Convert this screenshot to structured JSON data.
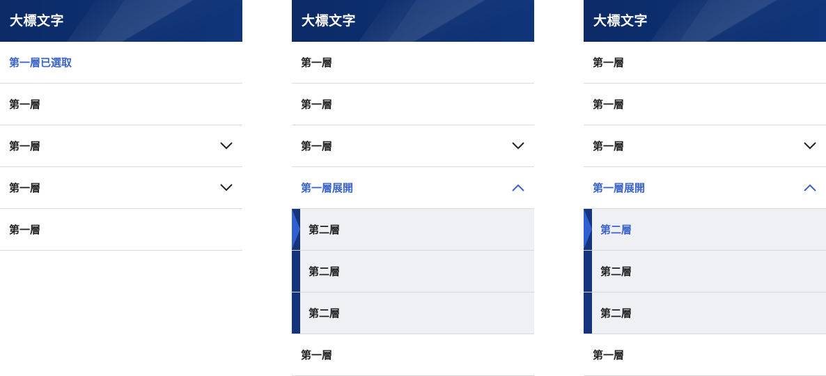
{
  "panels": [
    {
      "title": "大標文字",
      "items": [
        {
          "label": "第一層已選取",
          "active": true,
          "chevron": ""
        },
        {
          "label": "第一層",
          "active": false,
          "chevron": ""
        },
        {
          "label": "第一層",
          "active": false,
          "chevron": "down"
        },
        {
          "label": "第一層",
          "active": false,
          "chevron": "down"
        },
        {
          "label": "第一層",
          "active": false,
          "chevron": ""
        }
      ]
    },
    {
      "title": "大標文字",
      "items": [
        {
          "label": "第一層",
          "active": false,
          "chevron": ""
        },
        {
          "label": "第一層",
          "active": false,
          "chevron": ""
        },
        {
          "label": "第一層",
          "active": false,
          "chevron": "down"
        },
        {
          "label": "第一層展開",
          "active": true,
          "chevron": "up"
        }
      ],
      "sub_items": [
        {
          "label": "第二層",
          "active": false
        },
        {
          "label": "第二層",
          "active": false
        },
        {
          "label": "第二層",
          "active": false
        }
      ],
      "after_items": [
        {
          "label": "第一層",
          "active": false,
          "chevron": ""
        }
      ]
    },
    {
      "title": "大標文字",
      "items": [
        {
          "label": "第一層",
          "active": false,
          "chevron": ""
        },
        {
          "label": "第一層",
          "active": false,
          "chevron": ""
        },
        {
          "label": "第一層",
          "active": false,
          "chevron": "down"
        },
        {
          "label": "第一層展開",
          "active": true,
          "chevron": "up"
        }
      ],
      "sub_items": [
        {
          "label": "第二層",
          "active": true
        },
        {
          "label": "第二層",
          "active": false
        },
        {
          "label": "第二層",
          "active": false
        }
      ],
      "after_items": [
        {
          "label": "第一層",
          "active": false,
          "chevron": ""
        }
      ]
    }
  ],
  "colors": {
    "header_bg": "#0b2a66",
    "active_text": "#3a63c9",
    "sub_bg": "#eff0f4",
    "sub_bar": "#14357d"
  }
}
